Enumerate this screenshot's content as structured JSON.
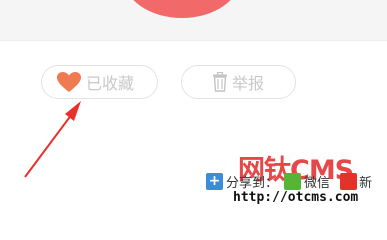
{
  "actions": {
    "like_label": "已收藏",
    "report_label": "举报"
  },
  "share": {
    "label": "分享到：",
    "wechat_label": "微信",
    "weibo_label": "新"
  },
  "watermark": {
    "brand": "网钛CMS",
    "url": "http://otcms.com"
  },
  "icons": {
    "like": "heart-icon",
    "report": "trash-icon",
    "share": "plus-icon",
    "wechat": "wechat-icon",
    "weibo": "weibo-icon"
  },
  "colors": {
    "accent": "#f2696a",
    "heart": "#f07a52",
    "annotation_arrow": "#e8312b",
    "watermark": "#e22828"
  }
}
